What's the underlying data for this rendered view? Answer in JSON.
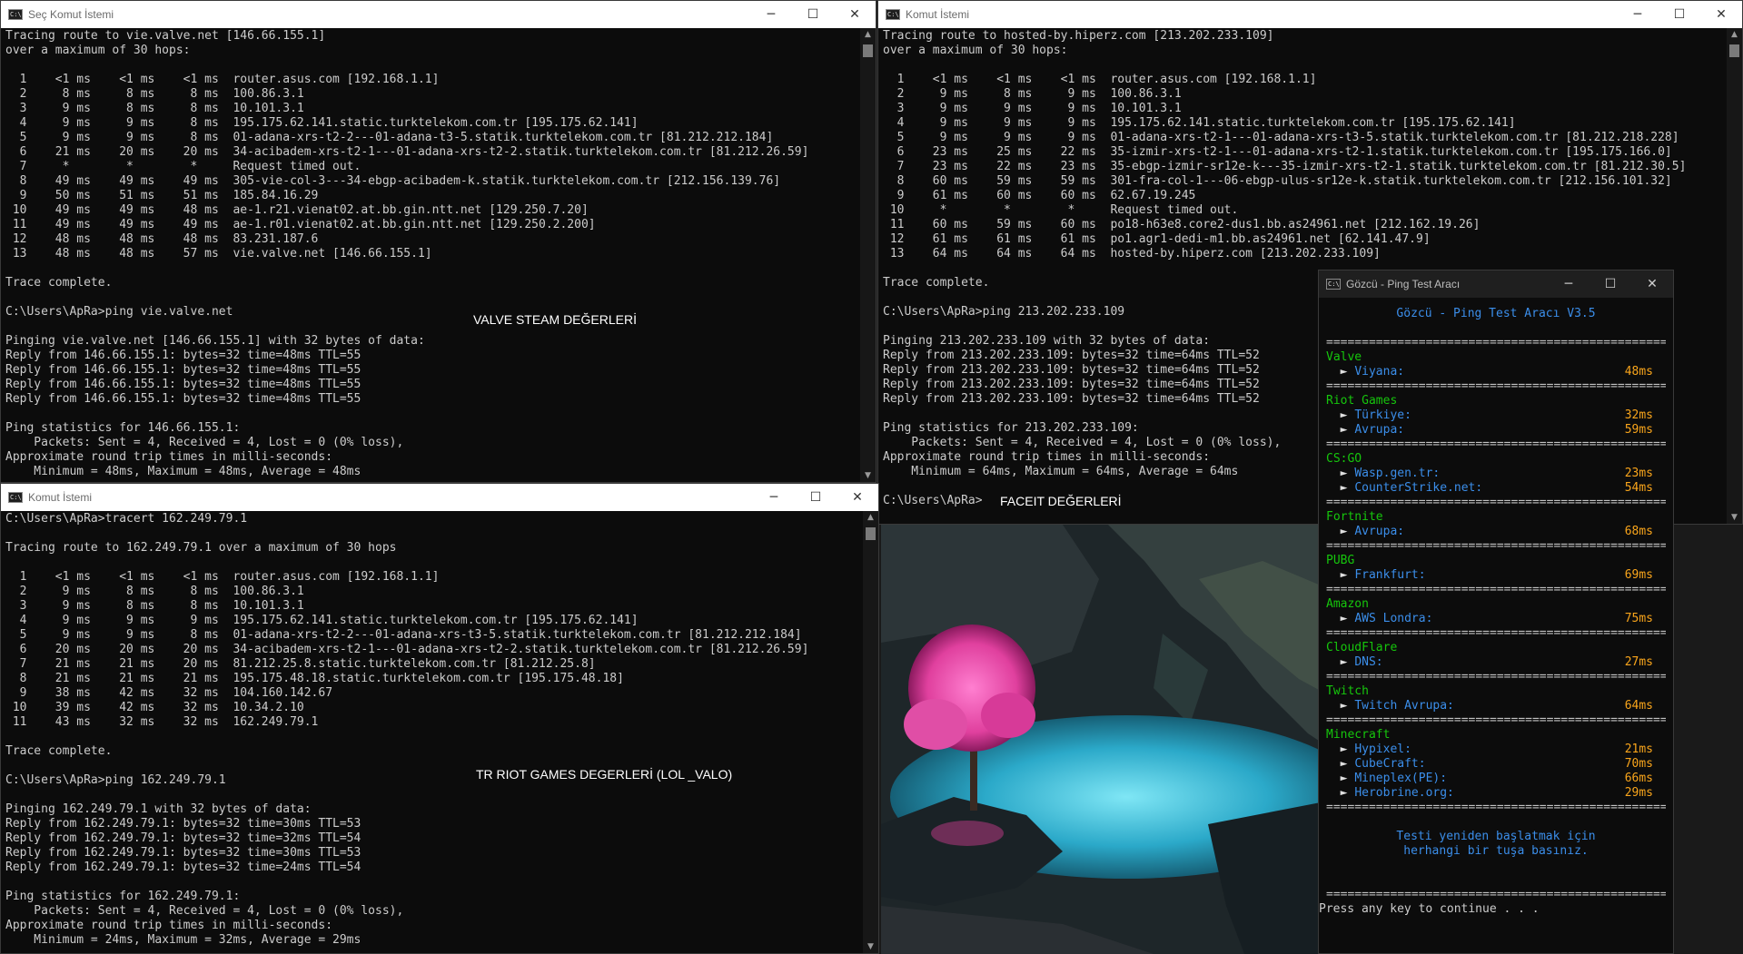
{
  "win_valve": {
    "title": "Seç Komut İstemi",
    "lines": [
      "Tracing route to vie.valve.net [146.66.155.1]",
      "over a maximum of 30 hops:",
      "",
      "  1    <1 ms    <1 ms    <1 ms  router.asus.com [192.168.1.1]",
      "  2     8 ms     8 ms     8 ms  100.86.3.1",
      "  3     9 ms     8 ms     8 ms  10.101.3.1",
      "  4     9 ms     9 ms     8 ms  195.175.62.141.static.turktelekom.com.tr [195.175.62.141]",
      "  5     9 ms     9 ms     8 ms  01-adana-xrs-t2-2---01-adana-t3-5.statik.turktelekom.com.tr [81.212.212.184]",
      "  6    21 ms    20 ms    20 ms  34-acibadem-xrs-t2-1---01-adana-xrs-t2-2.statik.turktelekom.com.tr [81.212.26.59]",
      "  7     *        *        *     Request timed out.",
      "  8    49 ms    49 ms    49 ms  305-vie-col-3---34-ebgp-acibadem-k.statik.turktelekom.com.tr [212.156.139.76]",
      "  9    50 ms    51 ms    51 ms  185.84.16.29",
      " 10    49 ms    49 ms    48 ms  ae-1.r21.vienat02.at.bb.gin.ntt.net [129.250.7.20]",
      " 11    49 ms    49 ms    49 ms  ae-1.r01.vienat02.at.bb.gin.ntt.net [129.250.2.200]",
      " 12    48 ms    48 ms    48 ms  83.231.187.6",
      " 13    48 ms    48 ms    57 ms  vie.valve.net [146.66.155.1]",
      "",
      "Trace complete.",
      "",
      "C:\\Users\\ApRa>ping vie.valve.net",
      "",
      "Pinging vie.valve.net [146.66.155.1] with 32 bytes of data:",
      "Reply from 146.66.155.1: bytes=32 time=48ms TTL=55",
      "Reply from 146.66.155.1: bytes=32 time=48ms TTL=55",
      "Reply from 146.66.155.1: bytes=32 time=48ms TTL=55",
      "Reply from 146.66.155.1: bytes=32 time=48ms TTL=55",
      "",
      "Ping statistics for 146.66.155.1:",
      "    Packets: Sent = 4, Received = 4, Lost = 0 (0% loss),",
      "Approximate round trip times in milli-seconds:",
      "    Minimum = 48ms, Maximum = 48ms, Average = 48ms"
    ],
    "overlay": "VALVE STEAM DEĞERLERİ"
  },
  "win_faceit": {
    "title": "Komut İstemi",
    "lines": [
      "Tracing route to hosted-by.hiperz.com [213.202.233.109]",
      "over a maximum of 30 hops:",
      "",
      "  1    <1 ms    <1 ms    <1 ms  router.asus.com [192.168.1.1]",
      "  2     9 ms     8 ms     9 ms  100.86.3.1",
      "  3     9 ms     9 ms     9 ms  10.101.3.1",
      "  4     9 ms     9 ms     9 ms  195.175.62.141.static.turktelekom.com.tr [195.175.62.141]",
      "  5     9 ms     9 ms     9 ms  01-adana-xrs-t2-1---01-adana-xrs-t3-5.statik.turktelekom.com.tr [81.212.218.228]",
      "  6    23 ms    25 ms    22 ms  35-izmir-xrs-t2-1---01-adana-xrs-t2-1.statik.turktelekom.com.tr [195.175.166.0]",
      "  7    23 ms    22 ms    23 ms  35-ebgp-izmir-sr12e-k---35-izmir-xrs-t2-1.statik.turktelekom.com.tr [81.212.30.5]",
      "  8    60 ms    59 ms    59 ms  301-fra-col-1---06-ebgp-ulus-sr12e-k.statik.turktelekom.com.tr [212.156.101.32]",
      "  9    61 ms    60 ms    60 ms  62.67.19.245",
      " 10     *        *        *     Request timed out.",
      " 11    60 ms    59 ms    60 ms  po18-h63e8.core2-dus1.bb.as24961.net [212.162.19.26]",
      " 12    61 ms    61 ms    61 ms  po1.agr1-dedi-m1.bb.as24961.net [62.141.47.9]",
      " 13    64 ms    64 ms    64 ms  hosted-by.hiperz.com [213.202.233.109]",
      "",
      "Trace complete.",
      "",
      "C:\\Users\\ApRa>ping 213.202.233.109",
      "",
      "Pinging 213.202.233.109 with 32 bytes of data:",
      "Reply from 213.202.233.109: bytes=32 time=64ms TTL=52",
      "Reply from 213.202.233.109: bytes=32 time=64ms TTL=52",
      "Reply from 213.202.233.109: bytes=32 time=64ms TTL=52",
      "Reply from 213.202.233.109: bytes=32 time=64ms TTL=52",
      "",
      "Ping statistics for 213.202.233.109:",
      "    Packets: Sent = 4, Received = 4, Lost = 0 (0% loss),",
      "Approximate round trip times in milli-seconds:",
      "    Minimum = 64ms, Maximum = 64ms, Average = 64ms",
      "",
      "C:\\Users\\ApRa>"
    ],
    "overlay": "FACEIT DEĞERLERİ"
  },
  "win_riot": {
    "title": "Komut İstemi",
    "lines": [
      "C:\\Users\\ApRa>tracert 162.249.79.1",
      "",
      "Tracing route to 162.249.79.1 over a maximum of 30 hops",
      "",
      "  1    <1 ms    <1 ms    <1 ms  router.asus.com [192.168.1.1]",
      "  2     9 ms     8 ms     8 ms  100.86.3.1",
      "  3     9 ms     8 ms     8 ms  10.101.3.1",
      "  4     9 ms     9 ms     9 ms  195.175.62.141.static.turktelekom.com.tr [195.175.62.141]",
      "  5     9 ms     9 ms     8 ms  01-adana-xrs-t2-2---01-adana-xrs-t3-5.statik.turktelekom.com.tr [81.212.212.184]",
      "  6    20 ms    20 ms    20 ms  34-acibadem-xrs-t2-1---01-adana-xrs-t2-2.statik.turktelekom.com.tr [81.212.26.59]",
      "  7    21 ms    21 ms    20 ms  81.212.25.8.static.turktelekom.com.tr [81.212.25.8]",
      "  8    21 ms    21 ms    21 ms  195.175.48.18.static.turktelekom.com.tr [195.175.48.18]",
      "  9    38 ms    42 ms    32 ms  104.160.142.67",
      " 10    39 ms    42 ms    32 ms  10.34.2.10",
      " 11    43 ms    32 ms    32 ms  162.249.79.1",
      "",
      "Trace complete.",
      "",
      "C:\\Users\\ApRa>ping 162.249.79.1",
      "",
      "Pinging 162.249.79.1 with 32 bytes of data:",
      "Reply from 162.249.79.1: bytes=32 time=30ms TTL=53",
      "Reply from 162.249.79.1: bytes=32 time=32ms TTL=54",
      "Reply from 162.249.79.1: bytes=32 time=30ms TTL=53",
      "Reply from 162.249.79.1: bytes=32 time=24ms TTL=54",
      "",
      "Ping statistics for 162.249.79.1:",
      "    Packets: Sent = 4, Received = 4, Lost = 0 (0% loss),",
      "Approximate round trip times in milli-seconds:",
      "    Minimum = 24ms, Maximum = 32ms, Average = 29ms"
    ],
    "overlay": "TR RIOT GAMES DEGERLERİ (LOL _VALO)"
  },
  "gozcu": {
    "title": "Gözcü - Ping Test Aracı",
    "header": "Gözcü - Ping Test Aracı V3.5",
    "separator": "=====================================================",
    "groups": [
      {
        "name": "Valve",
        "items": [
          {
            "label": "Viyana:",
            "value": "48ms"
          }
        ]
      },
      {
        "name": "Riot Games",
        "items": [
          {
            "label": "Türkiye:",
            "value": "32ms"
          },
          {
            "label": "Avrupa:",
            "value": "59ms"
          }
        ]
      },
      {
        "name": "CS:GO",
        "items": [
          {
            "label": "Wasp.gen.tr:",
            "value": "23ms"
          },
          {
            "label": "CounterStrike.net:",
            "value": "54ms"
          }
        ]
      },
      {
        "name": "Fortnite",
        "items": [
          {
            "label": "Avrupa:",
            "value": "68ms"
          }
        ]
      },
      {
        "name": "PUBG",
        "items": [
          {
            "label": "Frankfurt:",
            "value": "69ms"
          }
        ]
      },
      {
        "name": "Amazon",
        "items": [
          {
            "label": "AWS Londra:",
            "value": "75ms"
          }
        ]
      },
      {
        "name": "CloudFlare",
        "items": [
          {
            "label": "DNS:",
            "value": "27ms"
          }
        ]
      },
      {
        "name": "Twitch",
        "items": [
          {
            "label": "Twitch Avrupa:",
            "value": "64ms"
          }
        ]
      },
      {
        "name": "Minecraft",
        "items": [
          {
            "label": "Hypixel:",
            "value": "21ms"
          },
          {
            "label": "CubeCraft:",
            "value": "70ms"
          },
          {
            "label": "Mineplex(PE):",
            "value": "66ms"
          },
          {
            "label": "Herobrine.org:",
            "value": "29ms"
          }
        ]
      }
    ],
    "note_line1": "Testi yeniden başlatmak için",
    "note_line2": "herhangi bir tuşa basınız.",
    "press": "Press any key to continue . . ."
  },
  "icons": {
    "minimize": "─",
    "maximize": "☐",
    "close": "✕",
    "cmd": "C:\\",
    "scroll_up": "▲",
    "scroll_down": "▼",
    "arrow": "►"
  },
  "colors": {
    "terminal_bg": "#0c0c0c",
    "terminal_text": "#cccccc",
    "gozcu_header": "#3b8eea",
    "gozcu_category": "#16c60c",
    "gozcu_value": "#f9a51b"
  }
}
